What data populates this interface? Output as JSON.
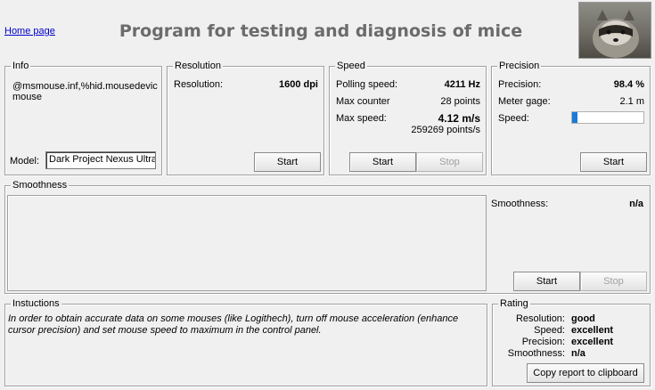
{
  "header": {
    "home_link": "Home page",
    "title": "Program for testing and diagnosis of mice",
    "logo_icon": "raccoon-photo"
  },
  "info": {
    "legend": "Info",
    "device_line1": "@msmouse.inf,%hid.mousedevic",
    "device_line2": "mouse",
    "model_label": "Model:",
    "model_value": "Dark Project Nexus Ultra"
  },
  "resolution": {
    "legend": "Resolution",
    "label": "Resolution:",
    "value": "1600 dpi",
    "start": "Start"
  },
  "speed": {
    "legend": "Speed",
    "polling_label": "Polling speed:",
    "polling_value": "4211 Hz",
    "counter_label": "Max counter",
    "counter_value": "28 points",
    "max_label": "Max  speed:",
    "max_value": "4.12 m/s",
    "max_points": "259269 points/s",
    "start": "Start",
    "stop": "Stop"
  },
  "precision": {
    "legend": "Precision",
    "precision_label": "Precision:",
    "precision_value": "98.4 %",
    "meter_label": "Meter gage:",
    "meter_value": "2.1 m",
    "speed_label": "Speed:",
    "speed_level_percent": 8,
    "start": "Start"
  },
  "smoothness": {
    "legend": "Smoothness",
    "label": "Smoothness:",
    "value": "n/a",
    "start": "Start",
    "stop": "Stop"
  },
  "instructions": {
    "legend": "Instuctions",
    "text": "In order to obtain accurate data on some mouses (like Logithech), turn off mouse acceleration (enhance cursor precision) and set mouse speed to maximum in the control panel."
  },
  "rating": {
    "legend": "Rating",
    "resolution_label": "Resolution:",
    "resolution_value": "good",
    "speed_label": "Speed:",
    "speed_value": "excellent",
    "precision_label": "Precision:",
    "precision_value": "excellent",
    "smoothness_label": "Smoothness:",
    "smoothness_value": "n/a",
    "copy_button": "Copy report to clipboard"
  },
  "colors": {
    "title": "#6b6b6b",
    "link": "#0000cc",
    "progress": "#1a7bd6"
  }
}
